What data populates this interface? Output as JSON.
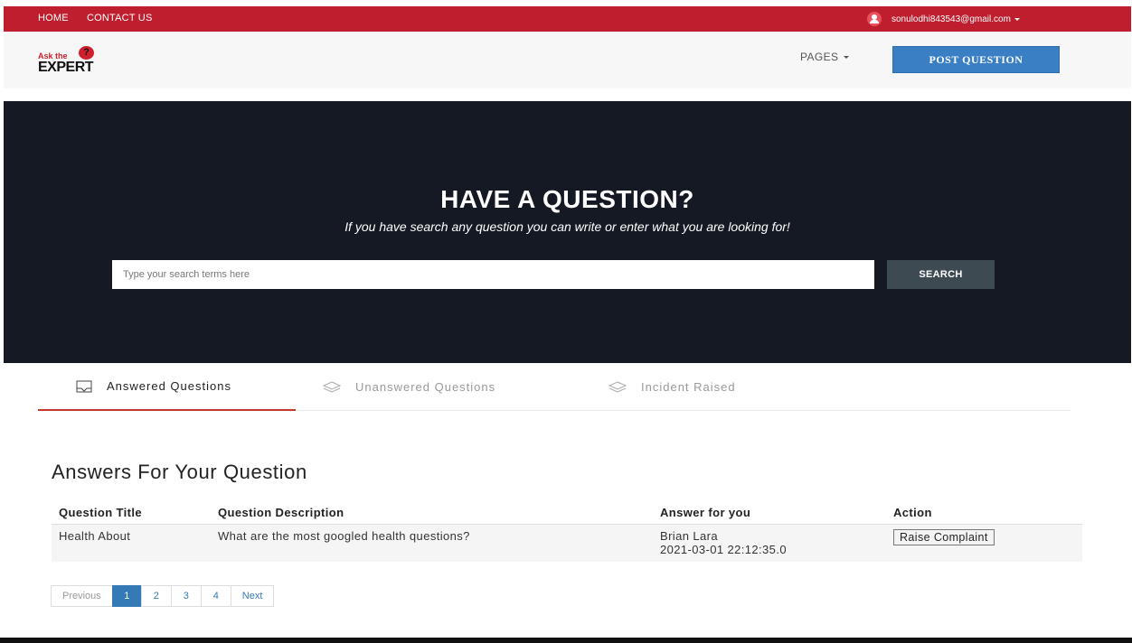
{
  "topbar": {
    "nav": [
      "HOME",
      "CONTACT US"
    ],
    "user_email": "sonulodhi843543@gmail.com"
  },
  "header": {
    "logo_top": "Ask the",
    "logo_bubble": "?",
    "logo_main": "EXPERT",
    "pages_label": "PAGES",
    "post_button": "POST QUESTION"
  },
  "hero": {
    "title": "HAVE A QUESTION?",
    "subtitle": "If you have search any question you can write or enter what you are looking for!",
    "search_placeholder": "Type your search terms here",
    "search_button": "SEARCH"
  },
  "tabs": [
    {
      "label": "Answered Questions",
      "icon": "inbox-icon",
      "active": true
    },
    {
      "label": "Unanswered Questions",
      "icon": "layers-icon",
      "active": false
    },
    {
      "label": "Incident Raised",
      "icon": "layers-icon",
      "active": false
    }
  ],
  "section": {
    "title": "Answers For Your Question",
    "columns": [
      "Question Title",
      "Question Description",
      "Answer for you",
      "Action"
    ],
    "rows": [
      {
        "title": "Health About",
        "description": "What are the most googled health questions?",
        "answer_name": "Brian Lara",
        "answer_date": "2021-03-01 22:12:35.0",
        "action": "Raise Complaint"
      }
    ]
  },
  "pagination": {
    "previous": "Previous",
    "pages": [
      "1",
      "2",
      "3",
      "4"
    ],
    "current": "1",
    "next": "Next"
  },
  "colors": {
    "topbar": "#bf1e2e",
    "hero_bg": "#141923",
    "primary_button": "#3a7fc4",
    "search_button": "#3e4a52",
    "active_tab_underline": "#c0392b"
  }
}
